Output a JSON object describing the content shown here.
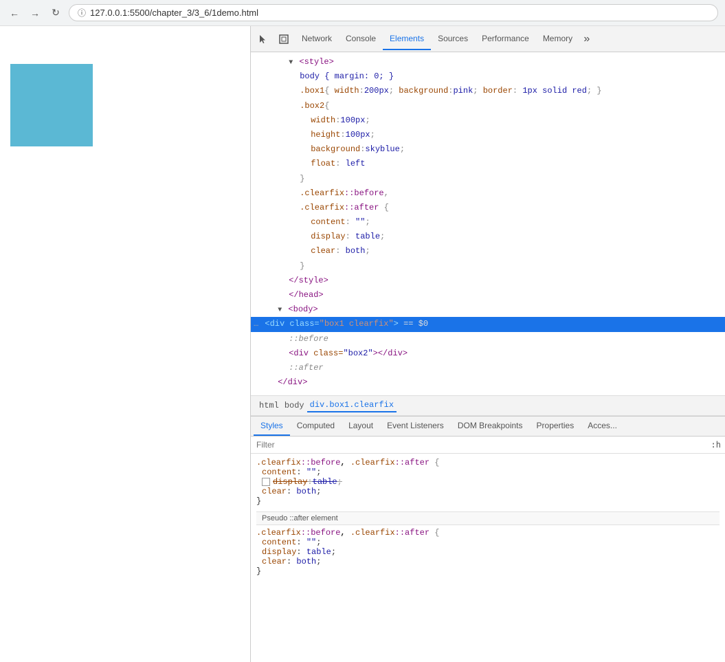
{
  "browser": {
    "url": "127.0.0.1:5500/chapter_3/3_6/1demo.html"
  },
  "devtools": {
    "tabs": [
      "Network",
      "Console",
      "Elements",
      "Sources",
      "Performance",
      "Memory"
    ],
    "active_tab": "Elements",
    "icons": [
      "cursor-icon",
      "box-icon"
    ]
  },
  "dom_tree": {
    "lines": [
      {
        "indent": 3,
        "content_type": "tag",
        "text": "<style>"
      },
      {
        "indent": 4,
        "content_type": "code",
        "text": "body { margin: 0; }"
      },
      {
        "indent": 4,
        "content_type": "code",
        "text": ".box1{ width:200px; background:pink; border: 1px solid red; }"
      },
      {
        "indent": 4,
        "content_type": "code",
        "text": ".box2{"
      },
      {
        "indent": 5,
        "content_type": "code",
        "text": "width:100px;"
      },
      {
        "indent": 5,
        "content_type": "code",
        "text": "height:100px;"
      },
      {
        "indent": 5,
        "content_type": "code",
        "text": "background:skyblue;"
      },
      {
        "indent": 5,
        "content_type": "code",
        "text": "float: left"
      },
      {
        "indent": 4,
        "content_type": "code",
        "text": "}"
      },
      {
        "indent": 4,
        "content_type": "code",
        "text": ".clearfix::before,"
      },
      {
        "indent": 4,
        "content_type": "code",
        "text": ".clearfix::after {"
      },
      {
        "indent": 5,
        "content_type": "code",
        "text": "content: \"\";"
      },
      {
        "indent": 5,
        "content_type": "code",
        "text": "display: table;"
      },
      {
        "indent": 5,
        "content_type": "code",
        "text": "clear: both;"
      },
      {
        "indent": 4,
        "content_type": "code",
        "text": "}"
      },
      {
        "indent": 3,
        "content_type": "tag",
        "text": "</style>"
      },
      {
        "indent": 3,
        "content_type": "tag",
        "text": "</head>"
      },
      {
        "indent": 2,
        "content_type": "tag_with_triangle",
        "text": "<body>"
      },
      {
        "indent": 2,
        "content_type": "selected",
        "text": "<div class=\"box1 clearfix\"> == $0"
      },
      {
        "indent": 3,
        "content_type": "pseudo",
        "text": "::before"
      },
      {
        "indent": 3,
        "content_type": "tag",
        "text": "<div class=\"box2\"></div>"
      },
      {
        "indent": 3,
        "content_type": "pseudo",
        "text": "::after"
      },
      {
        "indent": 2,
        "content_type": "tag",
        "text": "</div>"
      }
    ]
  },
  "breadcrumb": {
    "items": [
      "html",
      "body",
      "div.box1.clearfix"
    ]
  },
  "style_tabs": {
    "tabs": [
      "Styles",
      "Computed",
      "Layout",
      "Event Listeners",
      "DOM Breakpoints",
      "Properties",
      "Acces..."
    ],
    "active": "Styles"
  },
  "filter": {
    "placeholder": "Filter",
    "pseudo_btn": ":h"
  },
  "styles": {
    "rule1": {
      "selector": ".clearfix::before, .clearfix::after",
      "properties": [
        {
          "name": "content",
          "value": "\"\"",
          "strikethrough": false,
          "has_checkbox": false
        },
        {
          "name": "display",
          "value": "table",
          "strikethrough": true,
          "has_checkbox": true
        },
        {
          "name": "clear",
          "value": "both",
          "strikethrough": false,
          "has_checkbox": false
        }
      ]
    },
    "pseudo_section_label": "Pseudo ::after element",
    "rule2": {
      "selector": ".clearfix::before, .clearfix::after",
      "properties": [
        {
          "name": "content",
          "value": "\"\"",
          "strikethrough": false,
          "has_checkbox": false
        },
        {
          "name": "display",
          "value": "table",
          "strikethrough": false,
          "has_checkbox": false
        },
        {
          "name": "clear",
          "value": "both",
          "strikethrough": false,
          "has_checkbox": false
        }
      ]
    }
  }
}
